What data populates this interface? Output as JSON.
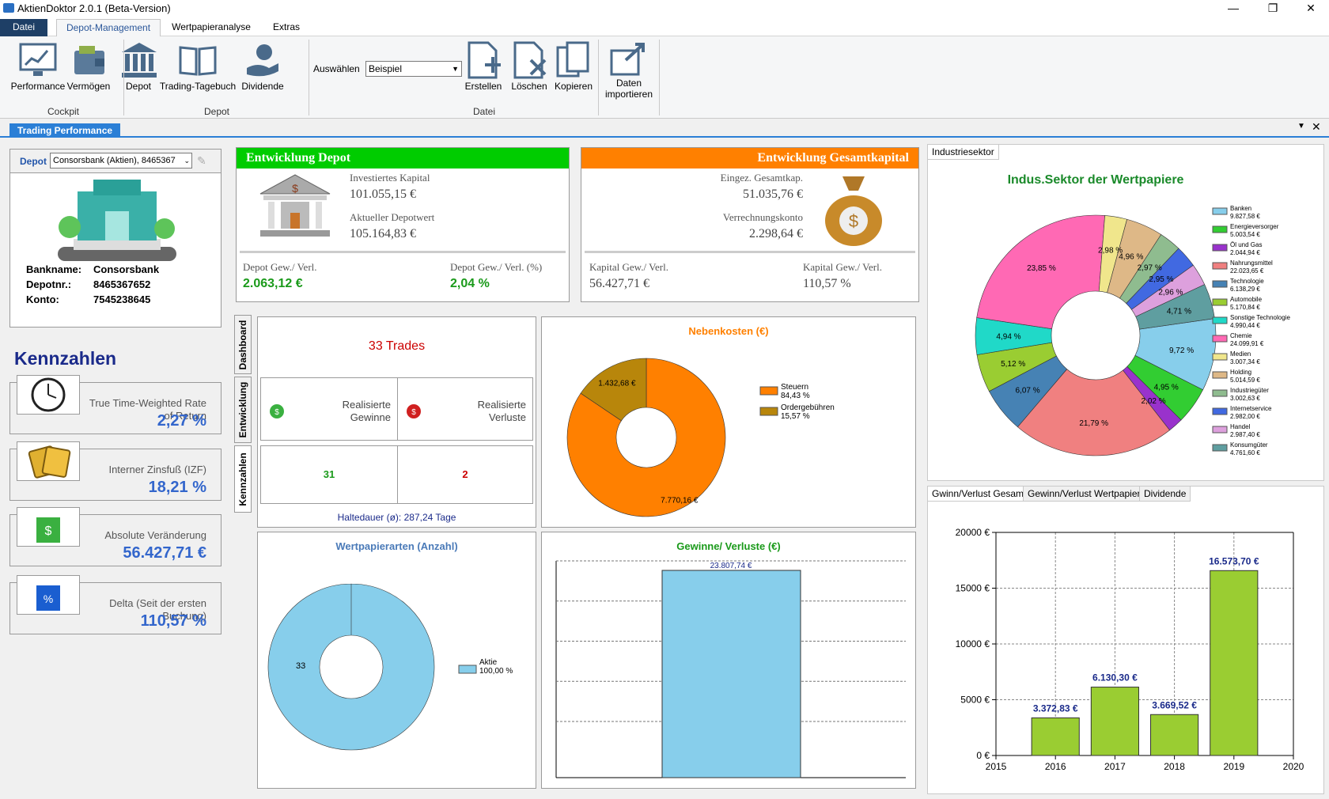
{
  "window": {
    "title": "AktienDoktor 2.0.1 (Beta-Version)"
  },
  "menu": {
    "tabs": [
      "Datei",
      "Depot-Management",
      "Wertpapieranalyse",
      "Extras"
    ]
  },
  "ribbon": {
    "buttons": {
      "performance": "Performance",
      "vermoegen": "Vermögen",
      "depot": "Depot",
      "tagebuch": "Trading-Tagebuch",
      "dividende": "Dividende",
      "erstellen": "Erstellen",
      "loeschen": "Löschen",
      "kopieren": "Kopieren",
      "daten1": "Daten",
      "daten2": "importieren"
    },
    "groups": {
      "cockpit": "Cockpit",
      "depot": "Depot",
      "datei": "Datei"
    },
    "select_label": "Auswählen",
    "select_value": "Beispiel"
  },
  "doc_tab": "Trading Performance",
  "depot_panel": {
    "label": "Depot",
    "selected": "Consorsbank (Aktien), 8465367",
    "bankname_label": "Bankname:",
    "bankname": "Consorsbank",
    "depotnr_label": "Depotnr.:",
    "depotnr": "8465367652",
    "konto_label": "Konto:",
    "konto": "7545238645"
  },
  "kennzahlen": {
    "title": "Kennzahlen",
    "items": [
      {
        "label": "True Time-Weighted Rate of Return",
        "value": "2,27 %"
      },
      {
        "label": "Interner Zinsfuß (IZF)",
        "value": "18,21 %"
      },
      {
        "label": "Absolute Veränderung",
        "value": "56.427,71 €"
      },
      {
        "label": "Delta (Seit der ersten Buchung)",
        "value": "110,57 %"
      }
    ]
  },
  "entwicklung_depot": {
    "title": "Entwicklung Depot",
    "investiert_label": "Investiertes Kapital",
    "investiert": "101.055,15 €",
    "aktuell_label": "Aktueller Depotwert",
    "aktuell": "105.164,83 €",
    "gv_label": "Depot Gew./ Verl.",
    "gv": "2.063,12 €",
    "gvp_label": "Depot Gew./ Verl. (%)",
    "gvp": "2,04 %",
    "color": "#00cc00"
  },
  "entwicklung_gesamt": {
    "title": "Entwicklung Gesamtkapital",
    "eingez_label": "Eingez. Gesamtkap.",
    "eingez": "51.035,76 €",
    "verrechnung_label": "Verrechnungskonto",
    "verrechnung": "2.298,64 €",
    "kgv_label": "Kapital Gew./ Verl.",
    "kgv": "56.427,71 €",
    "kgvp_label": "Kapital Gew./ Verl.",
    "kgvp": "110,57 %",
    "color": "#ff8000"
  },
  "side_tabs": [
    "Dashboard",
    "Entwicklung",
    "Kennzahlen"
  ],
  "trades": {
    "title": "33 Trades",
    "gewinne_label": "Realisierte Gewinne",
    "verluste_label": "Realisierte Verluste",
    "gewinne": "31",
    "verluste": "2",
    "haltedauer": "Haltedauer (ø): 287,24 Tage"
  },
  "nebenkosten": {
    "title": "Nebenkosten (€)",
    "slices": [
      {
        "name": "Steuern",
        "pct": "84,43 %",
        "value": 7770.16,
        "label": "7.770,16 €",
        "color": "#ff8000"
      },
      {
        "name": "Ordergebühren",
        "pct": "15,57 %",
        "value": 1432.68,
        "label": "1.432,68 €",
        "color": "#b8860b"
      }
    ]
  },
  "wertpapierarten": {
    "title": "Wertpapierarten (Anzahl)",
    "slices": [
      {
        "name": "Aktie",
        "pct": "100,00 %",
        "value": 33,
        "label": "33",
        "color": "#87ceeb"
      }
    ]
  },
  "gewinne_verluste": {
    "title": "Gewinne/ Verluste (€)",
    "bar_label": "23.807,74 €",
    "value": 23807.74
  },
  "industry_tab": "Industriesektor",
  "industry": {
    "title": "Indus.Sektor der Wertpapiere",
    "slices": [
      {
        "name": "Banken",
        "value": "9.827,58 €",
        "pct": "9,72 %",
        "v": 9.72,
        "color": "#87ceeb"
      },
      {
        "name": "Energieversorger",
        "value": "5.003,54 €",
        "pct": "4,95 %",
        "v": 4.95,
        "color": "#32cd32"
      },
      {
        "name": "Öl und Gas",
        "value": "2.044,94 €",
        "pct": "2,02 %",
        "v": 2.02,
        "color": "#9932cc"
      },
      {
        "name": "Nahrungsmittel",
        "value": "22.023,65 €",
        "pct": "21,79 %",
        "v": 21.79,
        "color": "#f08080"
      },
      {
        "name": "Technologie",
        "value": "6.138,29 €",
        "pct": "6,07 %",
        "v": 6.07,
        "color": "#4682b4"
      },
      {
        "name": "Automobile",
        "value": "5.170,84 €",
        "pct": "5,12 %",
        "v": 5.12,
        "color": "#9acd32"
      },
      {
        "name": "Sonstige Technologie",
        "value": "4.990,44 €",
        "pct": "4,94 %",
        "v": 4.94,
        "color": "#20d9c8"
      },
      {
        "name": "Chemie",
        "value": "24.099,91 €",
        "pct": "23,85 %",
        "v": 23.85,
        "color": "#ff69b4"
      },
      {
        "name": "Medien",
        "value": "3.007,34 €",
        "pct": "2,98 %",
        "v": 2.98,
        "color": "#f0e68c"
      },
      {
        "name": "Holding",
        "value": "5.014,59 €",
        "pct": "4,96 %",
        "v": 4.96,
        "color": "#deb887"
      },
      {
        "name": "Industriegüter",
        "value": "3.002,63 €",
        "pct": "2,97 %",
        "v": 2.97,
        "color": "#8fbc8f"
      },
      {
        "name": "Internetservice",
        "value": "2.982,00 €",
        "pct": "2,95 %",
        "v": 2.95,
        "color": "#4169e1"
      },
      {
        "name": "Handel",
        "value": "2.987,40 €",
        "pct": "2,96 %",
        "v": 2.96,
        "color": "#dda0dd"
      },
      {
        "name": "Konsumgüter",
        "value": "4.761,60 €",
        "pct": "4,71 %",
        "v": 4.71,
        "color": "#5f9ea0"
      }
    ]
  },
  "bottom_tabs": [
    "Gwinn/Verlust Gesamt",
    "Gewinn/Verlust Wertpapiere",
    "Dividende"
  ],
  "chart_data": {
    "type": "bar",
    "categories": [
      "2016",
      "2017",
      "2018",
      "2019"
    ],
    "values": [
      3372.83,
      6130.3,
      3669.52,
      16573.7
    ],
    "data_labels": [
      "3.372,83 €",
      "6.130,30 €",
      "3.669,52 €",
      "16.573,70 €"
    ],
    "x_ticks": [
      "2015",
      "2016",
      "2017",
      "2018",
      "2019",
      "2020"
    ],
    "y_ticks": [
      "0 €",
      "5000 €",
      "10000 €",
      "15000 €",
      "20000 €"
    ],
    "ylim": [
      0,
      20000
    ],
    "grid": true,
    "color": "#9acd32"
  }
}
